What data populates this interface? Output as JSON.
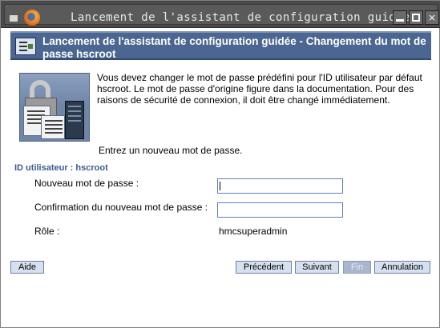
{
  "window": {
    "title": "Lancement de l'assistant de configuration guidée - C",
    "minimize_icon": "minimize-icon",
    "maximize_icon": "maximize-icon",
    "close_glyph": "×"
  },
  "banner": {
    "title": "Lancement de l'assistant de configuration guidée - Changement du mot de passe hscroot",
    "icon": "wizard-icon"
  },
  "intro": {
    "text": "Vous devez changer le mot de passe prédéfini pour l'ID utilisateur par défaut hscroot. Le mot de passe d'origine figure dans la documentation. Pour des raisons de sécurité de connexion, il doit être changé immédiatement.",
    "illustration": "security-illustration"
  },
  "prompt": "Entrez un nouveau mot de passe.",
  "section": {
    "title": "ID utilisateur : hscroot"
  },
  "form": {
    "new_password_label": "Nouveau mot de passe :",
    "new_password_value": "",
    "confirm_password_label": "Confirmation du nouveau mot de passe :",
    "confirm_password_value": "",
    "role_label": "Rôle :",
    "role_value": "hmcsuperadmin"
  },
  "buttons": {
    "help": "Aide",
    "previous": "Précédent",
    "next": "Suivant",
    "finish": "Fin",
    "cancel": "Annulation"
  },
  "colors": {
    "banner": "#4a6691",
    "section_title": "#3a5a90",
    "button": "#d6e0f0",
    "button_disabled": "#a9b6ce",
    "field_border": "#5b7dbe"
  }
}
